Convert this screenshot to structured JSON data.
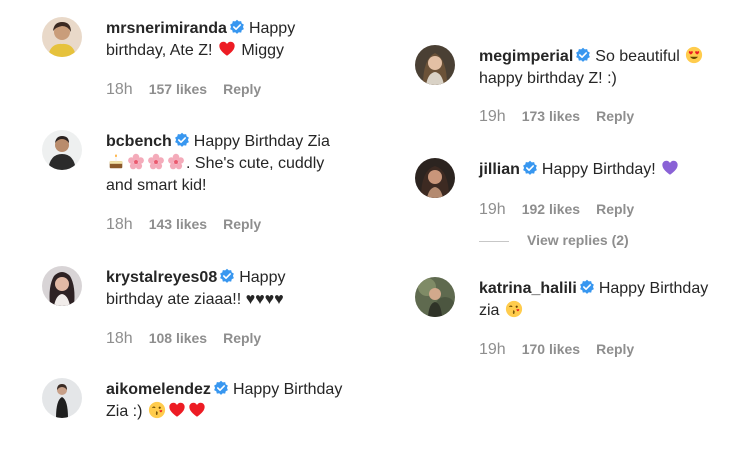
{
  "left": [
    {
      "username": "mrsnerimiranda",
      "text_1": "Happy",
      "text_2": "birthday, Ate Z!",
      "text_3": "Miggy",
      "time": "18h",
      "likes": "157 likes",
      "reply": "Reply"
    },
    {
      "username": "bcbench",
      "text_1": "Happy Birthday Zia",
      "text_2": ". She's cute, cuddly",
      "text_3": "and smart kid!",
      "time": "18h",
      "likes": "143 likes",
      "reply": "Reply"
    },
    {
      "username": "krystalreyes08",
      "text_1": "Happy",
      "text_2": "birthday ate ziaaa!! ♥♥♥♥",
      "time": "18h",
      "likes": "108 likes",
      "reply": "Reply"
    },
    {
      "username": "aikomelendez",
      "text_1": "Happy Birthday",
      "text_2": "Zia :)"
    }
  ],
  "right": [
    {
      "username": "megimperial",
      "text_1": "So beautiful",
      "text_2": "happy birthday Z! :)",
      "time": "19h",
      "likes": "173 likes",
      "reply": "Reply"
    },
    {
      "username": "jillian",
      "text_1": "Happy Birthday!",
      "time": "19h",
      "likes": "192 likes",
      "reply": "Reply",
      "view_replies": "View replies (2)"
    },
    {
      "username": "katrina_halili",
      "text_1": "Happy Birthday",
      "text_2": "zia",
      "time": "19h",
      "likes": "170 likes",
      "reply": "Reply"
    }
  ],
  "colors": {
    "verified": "#3897f0",
    "muted": "#8e8e8e",
    "heart": "#ed1c24",
    "purple_heart": "#8a62d6"
  },
  "icons": {
    "verified": "verified-badge-icon",
    "heart": "red-heart-icon",
    "purple_heart": "purple-heart-icon",
    "kiss": "kissing-face-icon",
    "heart_eyes": "heart-eyes-face-icon",
    "cake": "cake-icon",
    "blossom": "cherry-blossom-icon"
  }
}
